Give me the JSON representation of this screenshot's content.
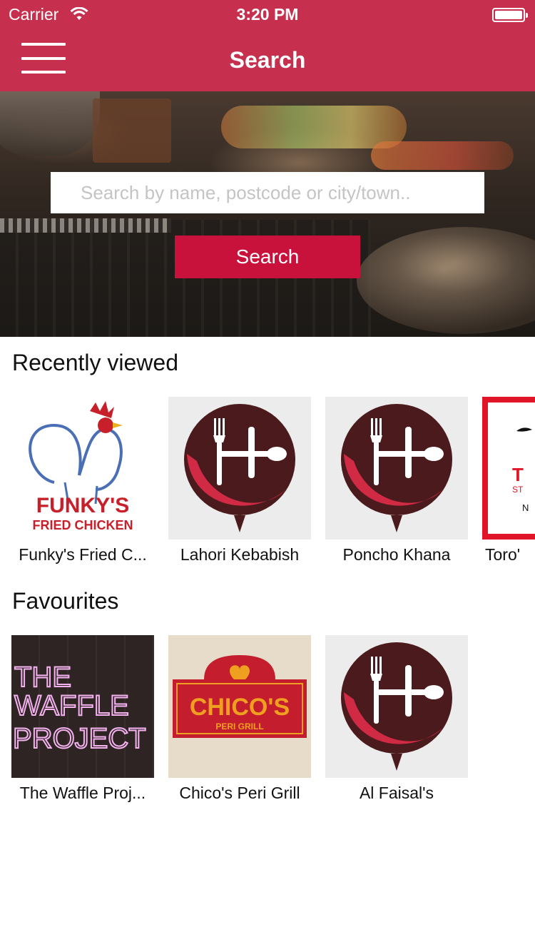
{
  "status_bar": {
    "carrier": "Carrier",
    "time": "3:20 PM"
  },
  "nav": {
    "title": "Search",
    "menu_icon": "hamburger-menu-icon"
  },
  "hero": {
    "search_placeholder": "Search by name, postcode or city/town..",
    "search_value": "",
    "search_button": "Search"
  },
  "recently_viewed": {
    "title": "Recently viewed",
    "items": [
      {
        "label": "Funky's Fried C...",
        "logo": "funkys-fried-chicken-logo",
        "logo_text": [
          "FUNKY'S",
          "FRIED CHICKEN"
        ]
      },
      {
        "label": "Lahori Kebabish",
        "logo": "fork-spoon-pin-logo"
      },
      {
        "label": "Poncho Khana",
        "logo": "fork-spoon-pin-logo"
      },
      {
        "label": "Toro'",
        "logo": "toros-logo",
        "logo_text": [
          "T",
          "ST",
          "N"
        ]
      }
    ]
  },
  "favourites": {
    "title": "Favourites",
    "items": [
      {
        "label": "The Waffle Proj...",
        "logo": "waffle-project-logo",
        "logo_text": [
          "THE",
          "WAFFLE",
          "PROJECT"
        ]
      },
      {
        "label": "Chico's Peri Grill",
        "logo": "chicos-peri-grill-logo",
        "logo_text": [
          "CHICO'S",
          "PERI GRILL"
        ]
      },
      {
        "label": "Al Faisal's",
        "logo": "fork-spoon-pin-logo"
      }
    ]
  },
  "colors": {
    "nav_bar": "#c6304e",
    "search_button": "#c8113b",
    "pin_dark": "#4a1a1c",
    "pin_red": "#d02a45",
    "thumb_bg": "#ececec"
  }
}
